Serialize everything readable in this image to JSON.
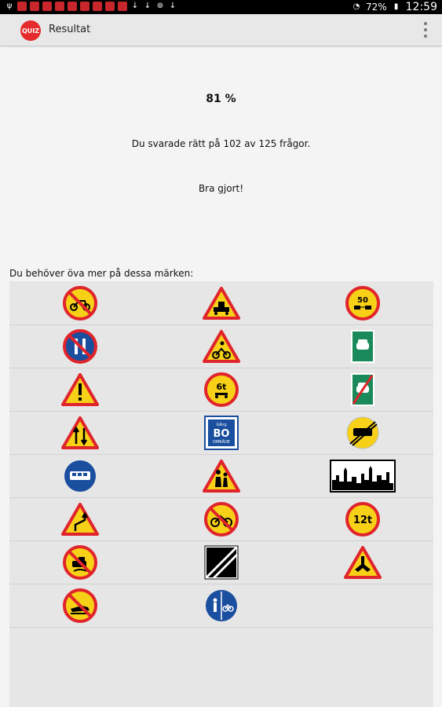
{
  "status_bar": {
    "battery": "72%",
    "time": "12:59"
  },
  "app_bar": {
    "logo_text": "QUIZ",
    "title": "Resultat"
  },
  "result": {
    "percent": "81 %",
    "summary": "Du svarade rätt på 102 av 125 frågor.",
    "praise": "Bra gjort!"
  },
  "practice": {
    "heading": "Du behöver öva mer på dessa märken:",
    "signs": [
      [
        "no-mopeds-sign",
        "level-crossing-warning-sign",
        "minimum-distance-sign"
      ],
      [
        "no-parking-odd-even-sign",
        "cyclists-warning-sign",
        "motorway-sign"
      ],
      [
        "other-danger-warning-sign",
        "max-axle-load-sign",
        "end-of-motorway-sign"
      ],
      [
        "two-way-traffic-warning-sign",
        "residential-area-sign",
        "end-of-restriction-sign"
      ],
      [
        "bus-lane-sign",
        "children-warning-sign",
        "built-up-area-sign"
      ],
      [
        "double-bend-warning-sign",
        "no-cycling-sign",
        "max-weight-sign"
      ],
      [
        "no-dangerous-goods-sign",
        "end-of-all-restrictions-sign",
        "junction-warning-sign"
      ],
      [
        "no-snowmobiles-sign",
        "pedestrian-cycle-path-sign",
        ""
      ]
    ],
    "sign_text": {
      "minimum_distance": "50",
      "axle_load": "6t",
      "max_weight": "12t",
      "residential_top": "Gång",
      "residential_mid": "BO",
      "residential_bottom": "OMRÅDE"
    }
  }
}
